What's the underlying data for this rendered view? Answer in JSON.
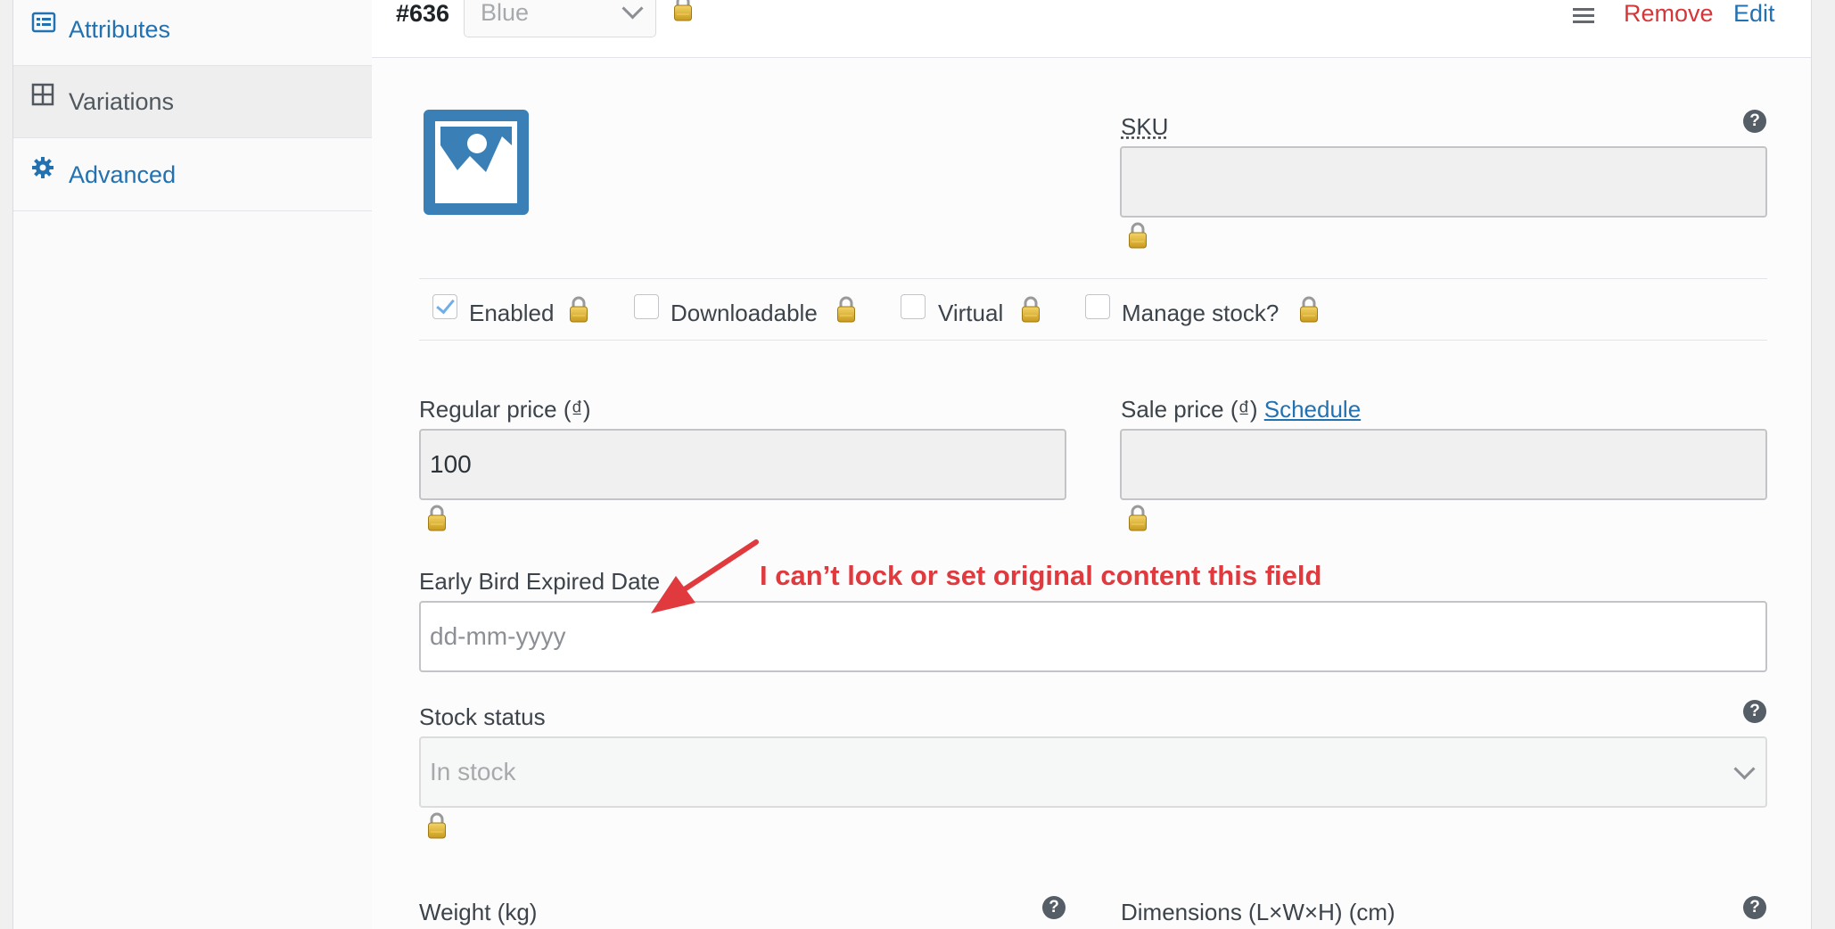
{
  "sidebar": {
    "items": [
      {
        "label": "Attributes",
        "icon": "attributes-icon"
      },
      {
        "label": "Variations",
        "icon": "grid-icon",
        "active": true
      },
      {
        "label": "Advanced",
        "icon": "gear-icon"
      }
    ]
  },
  "variation": {
    "id": "#636",
    "attribute_value": "Blue",
    "actions": {
      "remove": "Remove",
      "edit": "Edit"
    }
  },
  "fields": {
    "sku_label": "SKU",
    "sku_value": "",
    "regular_price_label": "Regular price (₫)",
    "regular_price_value": "100",
    "sale_price_label": "Sale price (₫)",
    "sale_price_schedule": "Schedule",
    "sale_price_value": "",
    "early_bird_label": "Early Bird Expired Date",
    "early_bird_placeholder": "dd-mm-yyyy",
    "stock_status_label": "Stock status",
    "stock_status_value": "In stock",
    "weight_label": "Weight (kg)",
    "dimensions_label": "Dimensions (L×W×H) (cm)"
  },
  "options": [
    {
      "label": "Enabled",
      "checked": true
    },
    {
      "label": "Downloadable",
      "checked": false
    },
    {
      "label": "Virtual",
      "checked": false
    },
    {
      "label": "Manage stock?",
      "checked": false
    }
  ],
  "help_glyph": "?",
  "annotation": "I can’t lock or set original content this field",
  "colors": {
    "link": "#2271b1",
    "remove": "#d63638",
    "annotation": "#e0393e",
    "image_placeholder": "#3a7fb5"
  }
}
